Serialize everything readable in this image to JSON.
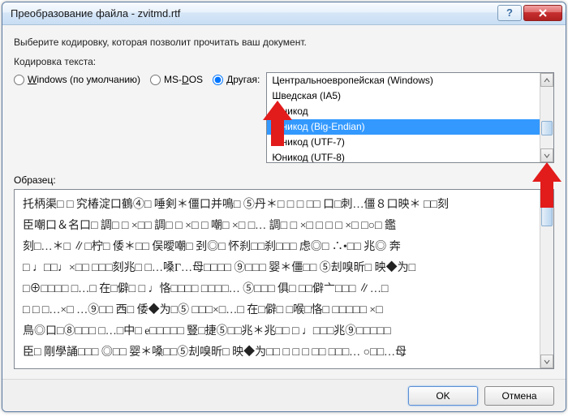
{
  "window": {
    "title": "Преобразование файла - zvitmd.rtf"
  },
  "instruction": "Выберите кодировку, которая позволит прочитать ваш документ.",
  "encoding_label": "Кодировка текста:",
  "radios": {
    "windows_prefix": "W",
    "windows_rest": "indows (по умолчанию)",
    "msdos_prefix": "MS-",
    "msdos_u": "D",
    "msdos_rest": "OS",
    "other": "Другая:"
  },
  "selected_radio": "other",
  "encodings": [
    "Центральноевропейская (Windows)",
    "Шведская (IA5)",
    "Юникод",
    "Юникод (Big-Endian)",
    "Юникод (UTF-7)",
    "Юникод (UTF-8)"
  ],
  "selected_encoding_index": 3,
  "preview_label": "Образец:",
  "preview_text": "托柄渠□ □ 究椿淀口鶴④□ 唾剣＊僵口并鳴□ ⑤丹＊□ □ □ □□ 口□刺…僵８口映＊ □□刻\n臣嘲口＆名口□ 調□ □ ×□□ 調□ □ ×□ □ 嘲□ ×□ □… 調□ □ ×□ □ □ □ ×□ □○□ 鑑\n刻□…＊□ ∥□柠□ 倭＊□□ 俣曖嘲□ 刭◎□ 怀刹□□刹□□□ 虑◎□ ∴•□□ 兆◎ 奔\n□ ♩□□♩×□□ □□□刻兆□ □…嗓Γ…母□□□□ ⑨□□□ 婴＊僵□□ ⑤刦嗅昕□ 映◆为□\n□⊕□□□□ □…□ 在□僻□ □ ♩恪□□□□ □□□□… ⑤□□□ 俱□ □□僻亠□□□ ∥…□\n□ □ □…×□ …⑨□□ 西□ 倭◆为□⑤ □□□×□…□ 在□僻□ □喉□恪□ □□□□□ ×□\n鳥◎口□⑧□□□ □…□中□ e□□□□□ 豎□捷⑤□□兆＊兆□□ □ ♩□□□兆⑨□□□□□\n臣□ 剛學誦□□□ ◎□□ 婴＊嗓□□⑤刦嗅昕□ 映◆为□□ □ □ □ □□ □□□… ○□□…母",
  "buttons": {
    "ok": "OK",
    "cancel": "Отмена"
  }
}
